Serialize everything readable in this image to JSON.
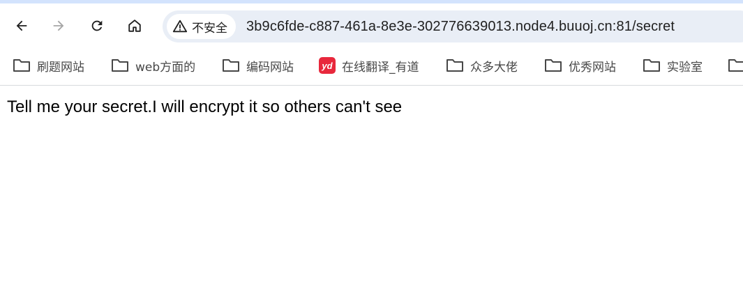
{
  "browser": {
    "security_label": "不安全",
    "url": "3b9c6fde-c887-461a-8e3e-302776639013.node4.buuoj.cn:81/secret"
  },
  "bookmarks": [
    {
      "label": "刷题网站",
      "icon": "folder-icon"
    },
    {
      "label": "web方面的",
      "icon": "folder-icon"
    },
    {
      "label": "编码网站",
      "icon": "folder-icon"
    },
    {
      "label": "在线翻译_有道",
      "icon": "youdao-icon",
      "icon_text": "yd"
    },
    {
      "label": "众多大佬",
      "icon": "folder-icon"
    },
    {
      "label": "优秀网站",
      "icon": "folder-icon"
    },
    {
      "label": "实验室",
      "icon": "folder-icon"
    }
  ],
  "page": {
    "text": "Tell me your secret.I will encrypt it so others can't see"
  },
  "colors": {
    "omnibox_bg": "#e9eef6",
    "youdao_red": "#e8283c",
    "text_dark": "#1f1f1f"
  }
}
